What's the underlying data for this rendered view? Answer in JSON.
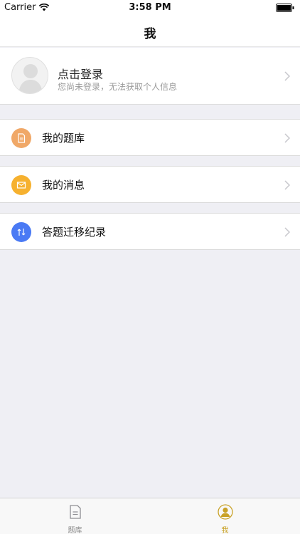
{
  "status_bar": {
    "carrier": "Carrier",
    "time": "3:58 PM"
  },
  "nav": {
    "title": "我"
  },
  "profile": {
    "login_label": "点击登录",
    "hint": "您尚未登录，无法获取个人信息"
  },
  "menu": [
    {
      "label": "我的题库",
      "icon": "document-icon",
      "color": "#f0a868"
    },
    {
      "label": "我的消息",
      "icon": "mail-icon",
      "color": "#f6b12f"
    },
    {
      "label": "答题迁移纪录",
      "icon": "transfer-icon",
      "color": "#4a7af4"
    }
  ],
  "tabs": [
    {
      "label": "题库",
      "icon": "document-tab-icon",
      "active": false
    },
    {
      "label": "我",
      "icon": "person-tab-icon",
      "active": true
    }
  ],
  "colors": {
    "accent": "#c9a227",
    "background": "#efeff4"
  }
}
